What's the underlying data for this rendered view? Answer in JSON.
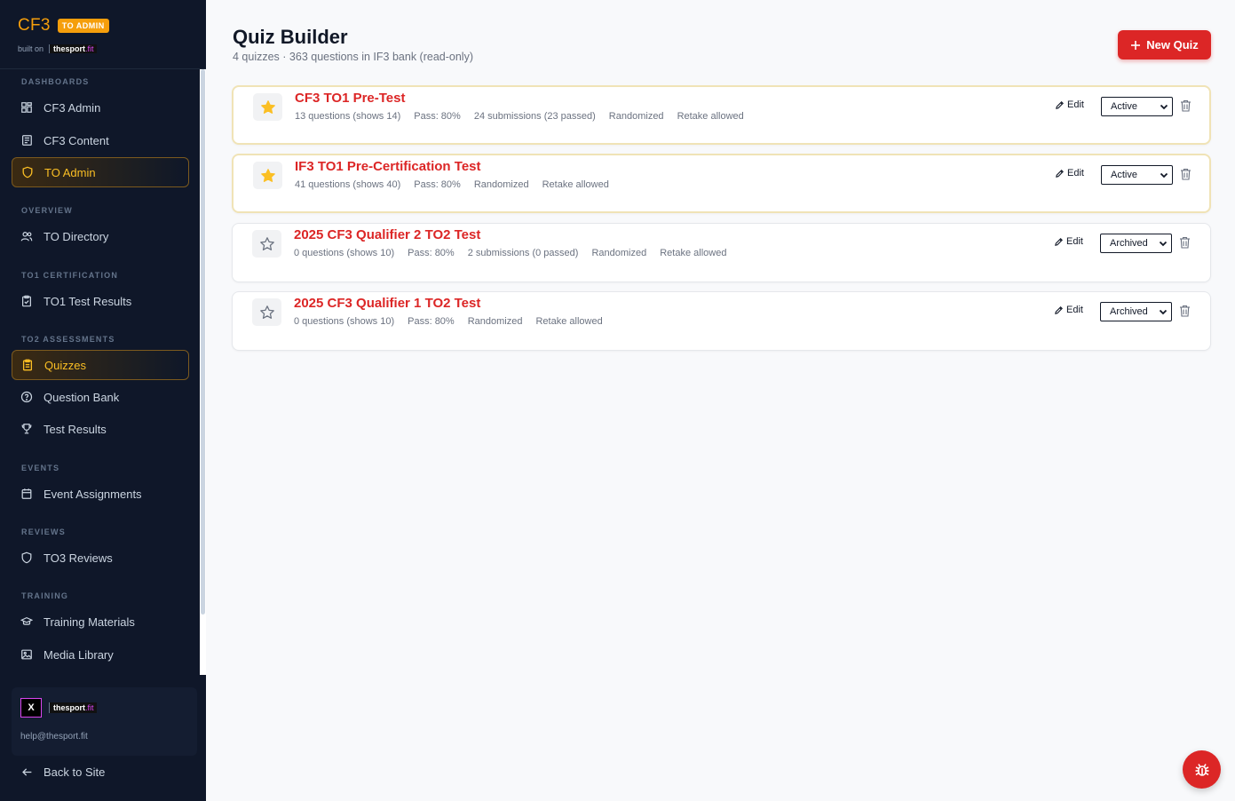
{
  "brand": {
    "name": "CF3",
    "badge": "TO ADMIN",
    "built_on": "built on",
    "logo_main": "thesport",
    "logo_sub": ".fit"
  },
  "nav": {
    "sections": {
      "dashboards": "DASHBOARDS",
      "overview": "OVERVIEW",
      "to1": "TO1 CERTIFICATION",
      "to2": "TO2 ASSESSMENTS",
      "events": "EVENTS",
      "reviews": "REVIEWS",
      "training": "TRAINING"
    },
    "items": {
      "cf3_admin": "CF3 Admin",
      "cf3_content": "CF3 Content",
      "to_admin": "TO Admin",
      "to_directory": "TO Directory",
      "to1_results": "TO1 Test Results",
      "quizzes": "Quizzes",
      "question_bank": "Question Bank",
      "test_results": "Test Results",
      "event_assignments": "Event Assignments",
      "to3_reviews": "TO3 Reviews",
      "training_materials": "Training Materials",
      "media_library": "Media Library"
    }
  },
  "footer": {
    "logo_mark": "X",
    "logo_main": "thesport",
    "logo_sub": ".fit",
    "email": "help@thesport.fit",
    "back": "Back to Site"
  },
  "header": {
    "title": "Quiz Builder",
    "subtitle": "4 quizzes · 363 questions in IF3 bank (read-only)",
    "new_button": "New Quiz"
  },
  "quizzes": [
    {
      "title": "CF3 TO1 Pre-Test",
      "featured": true,
      "meta": [
        "13 questions (shows 14)",
        "Pass: 80%",
        "24 submissions (23 passed)",
        "Randomized",
        "Retake allowed"
      ],
      "edit": "Edit",
      "status": "Active"
    },
    {
      "title": "IF3 TO1 Pre-Certification Test",
      "featured": true,
      "meta": [
        "41 questions (shows 40)",
        "Pass: 80%",
        "Randomized",
        "Retake allowed"
      ],
      "edit": "Edit",
      "status": "Active"
    },
    {
      "title": "2025 CF3 Qualifier 2 TO2 Test",
      "featured": false,
      "meta": [
        "0 questions (shows 10)",
        "Pass: 80%",
        "2 submissions (0 passed)",
        "Randomized",
        "Retake allowed"
      ],
      "edit": "Edit",
      "status": "Archived"
    },
    {
      "title": "2025 CF3 Qualifier 1 TO2 Test",
      "featured": false,
      "meta": [
        "0 questions (shows 10)",
        "Pass: 80%",
        "Randomized",
        "Retake allowed"
      ],
      "edit": "Edit",
      "status": "Archived"
    }
  ],
  "colors": {
    "accent": "#dc2626",
    "brand": "#f59e0b",
    "sidebar_bg": "#0f1729",
    "star": "#fbbf24"
  }
}
